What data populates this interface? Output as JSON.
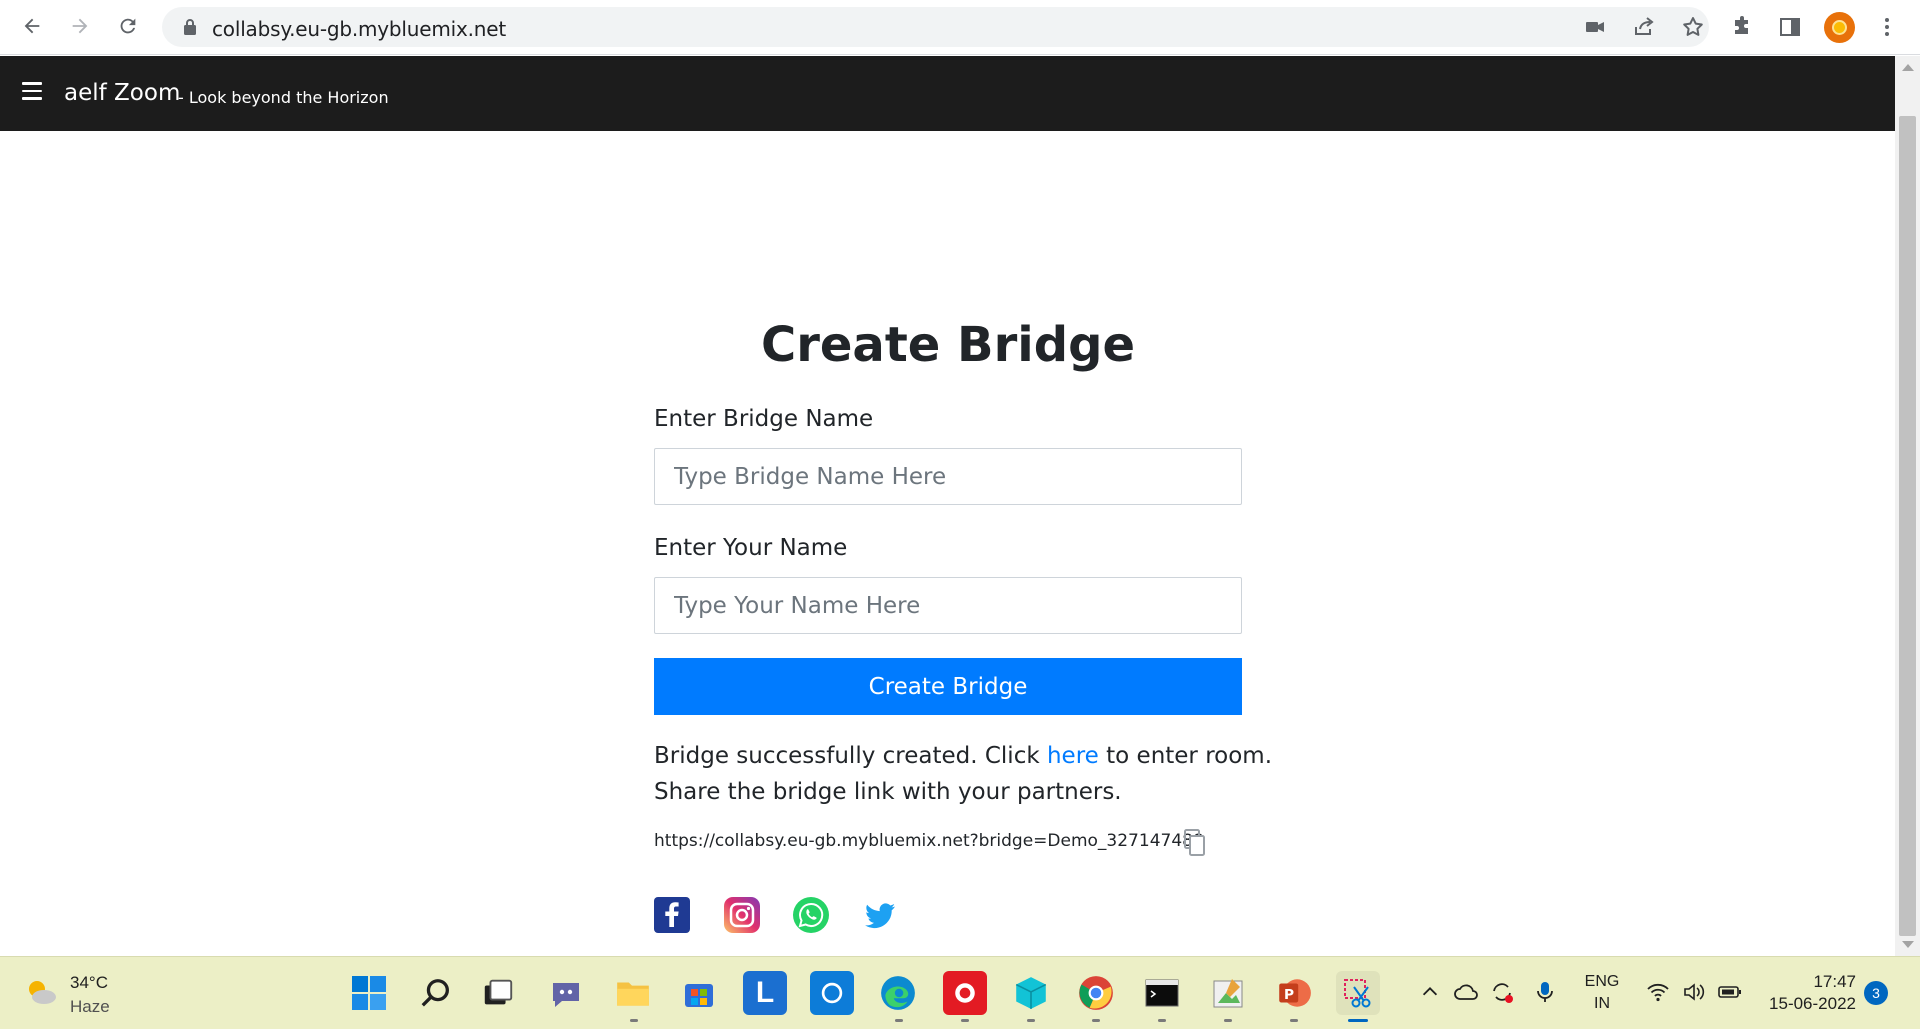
{
  "browser": {
    "url": "collabsy.eu-gb.mybluemix.net",
    "icons": [
      "back-arrow-icon",
      "forward-arrow-icon",
      "reload-icon",
      "lock-icon",
      "camera-icon",
      "share-icon",
      "star-icon",
      "extensions-icon",
      "side-panel-icon",
      "profile-avatar",
      "menu-dots-icon"
    ]
  },
  "navbar": {
    "brand": "aelf Zoom",
    "tagline": "- Look beyond the Horizon",
    "background": "#1c1c1c"
  },
  "form": {
    "title": "Create Bridge",
    "bridge_name_label": "Enter Bridge Name",
    "bridge_name_placeholder": "Type Bridge Name Here",
    "bridge_name_value": "",
    "your_name_label": "Enter Your Name",
    "your_name_placeholder": "Type Your Name Here",
    "your_name_value": "",
    "submit_label": "Create Bridge",
    "accent": "#007bff"
  },
  "result": {
    "message_before": "Bridge successfully created. Click ",
    "message_link": "here",
    "message_after": " to enter room.",
    "message_line2": "Share the bridge link with your partners.",
    "bridge_link": "https://collabsy.eu-gb.mybluemix.net?bridge=Demo_327147488"
  },
  "social": [
    "facebook-icon",
    "instagram-icon",
    "whatsapp-icon",
    "twitter-icon"
  ],
  "taskbar": {
    "weather_temp": "34°C",
    "weather_desc": "Haze",
    "lang_top": "ENG",
    "lang_bottom": "IN",
    "time": "17:47",
    "date": "15-06-2022",
    "notification_count": "3"
  }
}
